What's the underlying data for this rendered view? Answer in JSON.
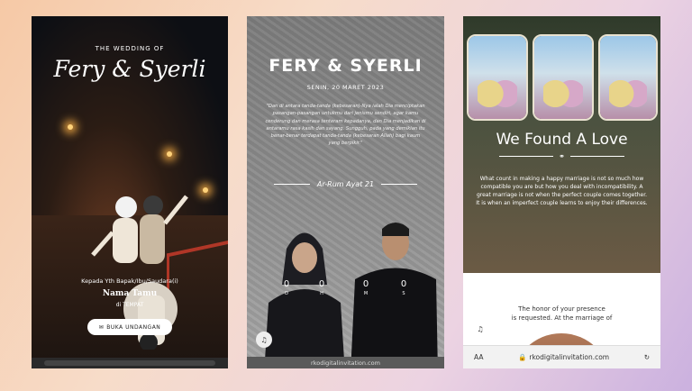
{
  "phone1": {
    "pre_title": "THE WEDDING OF",
    "couple_script": "Fery & Syerli",
    "to_line": "Kepada Yth Bapak/Ibu/Saudara(i)",
    "guest_name": "Nama Tamu",
    "place": "di TEMPAT",
    "open_button": "BUKA UNDANGAN",
    "open_icon": "envelope-icon"
  },
  "phone2": {
    "title": "FERY & SYERLI",
    "date": "SENIN, 20 MARET 2023",
    "quote": "\"Dan di antara tanda-tanda (kebesaran)-Nya ialah Dia menciptakan pasangan-pasangan untukmu dari jenismu sendiri, agar kamu cenderung dan merasa tenteram kepadanya, dan Dia menjadikan di antaramu rasa kasih dan sayang. Sungguh, pada yang demikian itu benar-benar terdapat tanda-tanda (kebesaran Allah) bagi kaum yang berpikir.\"",
    "verse": "Ar-Rum Ayat 21",
    "countdown": [
      {
        "value": "0",
        "label": "D"
      },
      {
        "value": "0",
        "label": "H"
      },
      {
        "value": "0",
        "label": "M"
      },
      {
        "value": "0",
        "label": "S"
      }
    ],
    "url": "rkodigitalinvitation.com"
  },
  "phone3": {
    "heading": "We Found A Love",
    "paragraph": "What count in making a happy marriage is not so much how compatible you are but how you deal with incompatibility. A great marriage is not when the perfect couple comes together. It is when an imperfect couple learns to enjoy their differences.",
    "honor_line1": "The honor of your presence",
    "honor_line2": "is requested. At the marriage of",
    "url_aa": "AA",
    "url": "rkodigitalinvitation.com"
  }
}
